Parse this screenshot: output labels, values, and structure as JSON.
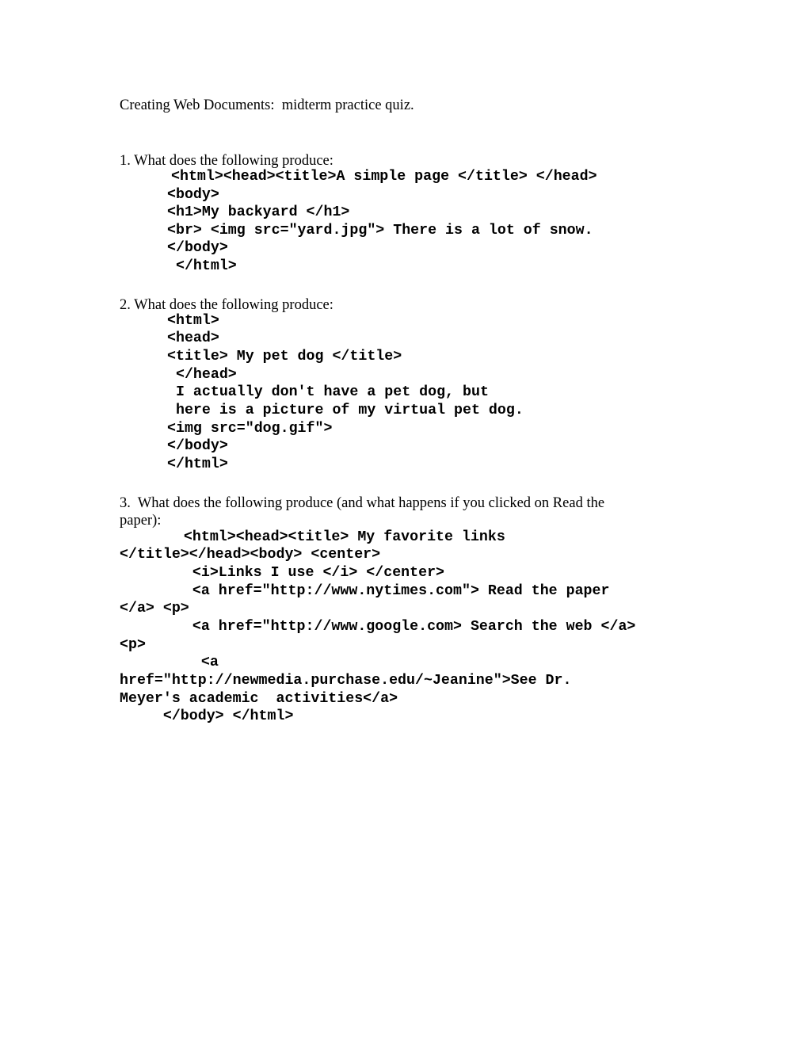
{
  "document": {
    "title": "Creating Web Documents:  midterm practice quiz.",
    "questions": [
      {
        "prompt": "1. What does the following produce:",
        "code": [
          "<html><head><title>A simple page </title> </head>",
          "<body>",
          "<h1>My backyard </h1>",
          "<br> <img src=\"yard.jpg\"> There is a lot of snow.",
          "</body>",
          " </html>"
        ]
      },
      {
        "prompt": "2. What does the following produce:",
        "code": [
          "<html>",
          "<head>",
          "<title> My pet dog </title>",
          " </head>",
          " I actually don't have a pet dog, but",
          " here is a picture of my virtual pet dog.",
          "<img src=\"dog.gif\">",
          "</body>",
          "</html>"
        ]
      },
      {
        "prompt_line1": "3.  What does the following produce (and what happens if you clicked on Read the",
        "prompt_line2": "paper):",
        "code": [
          "   <html><head><title> My favorite links",
          "</title></head><body> <center>",
          "    <i>Links I use </i> </center>",
          "    <a href=\"http://www.nytimes.com\"> Read the paper",
          "</a> <p>",
          "    <a href=\"http://www.google.com> Search the web </a>",
          "<p>",
          "     <a",
          "href=\"http://newmedia.purchase.edu/~Jeanine\">See Dr.",
          "Meyer's academic  activities</a>",
          "     </body> </html>"
        ]
      }
    ]
  }
}
